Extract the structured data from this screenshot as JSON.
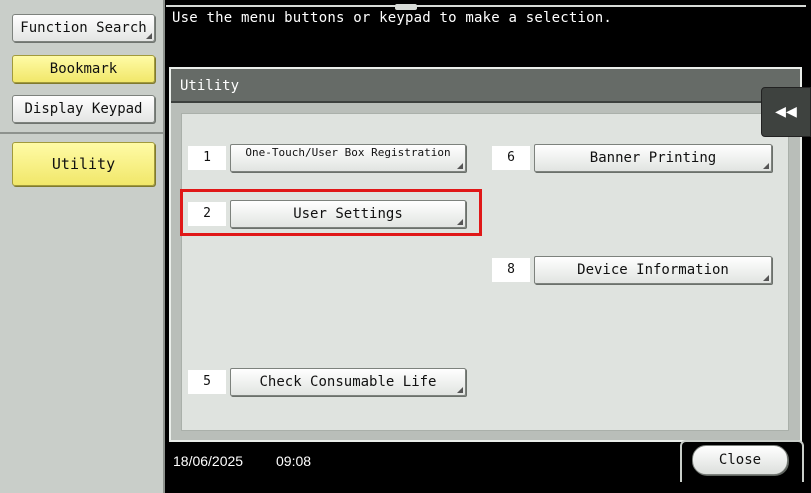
{
  "header": {
    "message": "Use the menu buttons or keypad to make a selection."
  },
  "sidebar": {
    "function_search": "Function Search",
    "bookmark": "Bookmark",
    "display_keypad": "Display Keypad",
    "utility": "Utility"
  },
  "panel": {
    "title": "Utility",
    "items": [
      {
        "num": "1",
        "label": "One-Touch/User Box Registration"
      },
      {
        "num": "2",
        "label": "User Settings"
      },
      {
        "num": "5",
        "label": "Check Consumable Life"
      },
      {
        "num": "6",
        "label": "Banner Printing"
      },
      {
        "num": "8",
        "label": "Device Information"
      }
    ]
  },
  "status": {
    "date": "18/06/2025",
    "time": "09:08"
  },
  "footer": {
    "close": "Close"
  },
  "icons": {
    "collapse": "double-left-arrow-icon"
  },
  "colors": {
    "highlight": "#e01818",
    "yellow_button": "#f6ed78",
    "title_bar": "#666b67"
  }
}
